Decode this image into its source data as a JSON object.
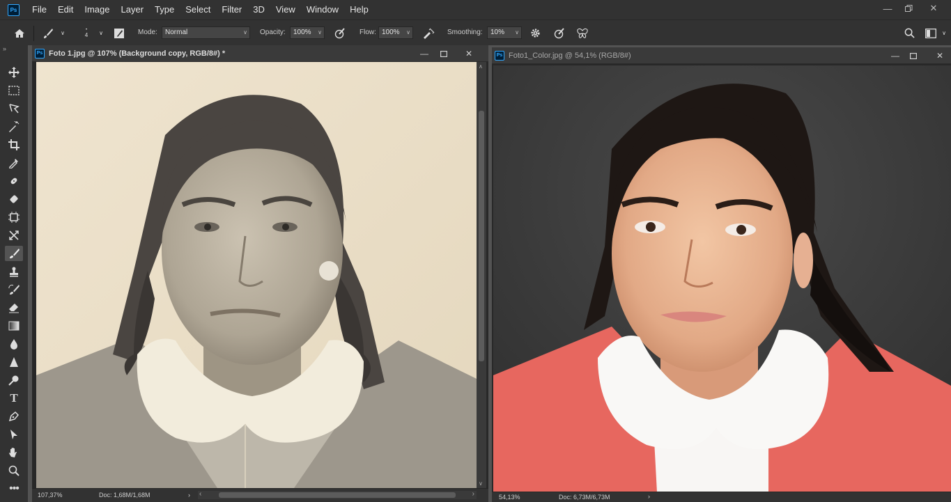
{
  "app": {
    "logo": "Ps"
  },
  "menu": [
    "File",
    "Edit",
    "Image",
    "Layer",
    "Type",
    "Select",
    "Filter",
    "3D",
    "View",
    "Window",
    "Help"
  ],
  "window_controls": {
    "minimize": "minimize-icon",
    "restore": "restore-icon",
    "close": "close-icon"
  },
  "options": {
    "mode_label": "Mode:",
    "mode_value": "Normal",
    "opacity_label": "Opacity:",
    "opacity_value": "100%",
    "flow_label": "Flow:",
    "flow_value": "100%",
    "smoothing_label": "Smoothing:",
    "smoothing_value": "10%",
    "brush_size": "4"
  },
  "tools": [
    "move-tool-icon",
    "marquee-tool-icon",
    "lasso-tool-icon",
    "magic-wand-icon",
    "crop-tool-icon",
    "eyedropper-icon",
    "healing-brush-icon",
    "patch-icon",
    "frame-tool-icon",
    "content-aware-move-icon",
    "brush-tool-icon",
    "clone-stamp-icon",
    "history-brush-icon",
    "eraser-icon",
    "gradient-icon",
    "blur-tool-icon",
    "sharpen-icon",
    "dodge-tool-icon",
    "type-tool-icon",
    "pen-tool-icon",
    "path-selection-icon",
    "hand-tool-icon",
    "zoom-tool-icon",
    "more-tools-icon"
  ],
  "documents": [
    {
      "logo": "Ps",
      "title": "Foto 1.jpg @ 107% (Background copy, RGB/8#) *",
      "zoom": "107,37%",
      "doc": "Doc: 1,68M/1,68M"
    },
    {
      "logo": "Ps",
      "title": "Foto1_Color.jpg @ 54,1% (RGB/8#)",
      "zoom": "54,13%",
      "doc": "Doc: 6,73M/6,73M"
    }
  ],
  "colors": {
    "accent": "#31a8ff",
    "chrome": "#323232",
    "workspace": "#535353"
  }
}
